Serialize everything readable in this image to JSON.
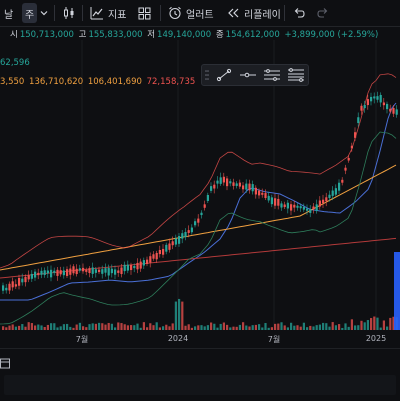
{
  "toolbar": {
    "day_label": "날",
    "week_label": "주",
    "indicators_label": "지표",
    "alerts_label": "얼러트",
    "replay_label": "리플레이"
  },
  "legend": {
    "ohlc": {
      "open_label": "시",
      "open_value": "150,713,000",
      "high_label": "고",
      "high_value": "155,833,000",
      "low_label": "저",
      "low_value": "149,140,000",
      "close_label": "종",
      "close_value": "154,612,000",
      "change": "+3,899,000 (+2.59%)"
    },
    "indicator_value": "62,596",
    "ma_values": [
      "3,550",
      "136,710,620",
      "106,401,690",
      "72,158,735"
    ]
  },
  "x_axis": {
    "labels": [
      "7월",
      "2024",
      "7월",
      "2025"
    ]
  },
  "colors": {
    "up": "#26a69a",
    "down": "#ef5350",
    "bb": "#ef5350",
    "ma_blue": "#4a6fd6",
    "ma_orange": "#f0a040",
    "ma_green": "#2e7d5b",
    "highlight": "#2962ff"
  },
  "drawing_tools": [
    "trend-line-icon",
    "horizontal-ray-icon",
    "parallel-channel-icon",
    "fib-retracement-icon"
  ],
  "icons": {
    "chart_type": "candles-icon",
    "indicators": "function-icon",
    "layouts": "grid-icon",
    "alerts": "alarm-clock-icon",
    "replay": "replay-icon",
    "undo": "undo-icon",
    "redo": "redo-icon"
  }
}
